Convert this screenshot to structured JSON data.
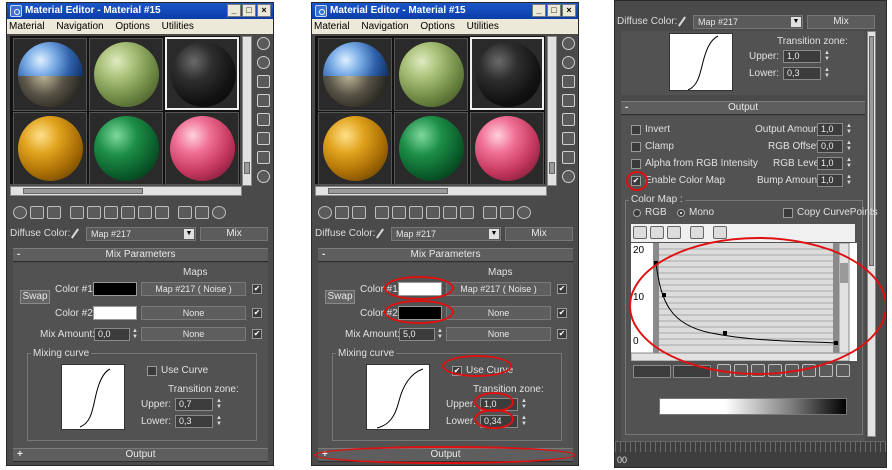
{
  "left_window": {
    "title": "Material Editor - Material #15",
    "menu": [
      "Material",
      "Navigation",
      "Options",
      "Utilities"
    ],
    "diffuse_label": "Diffuse Color:",
    "map_name": "Map #217",
    "mix_button": "Mix",
    "mix_params_title": "Mix Parameters",
    "maps_header": "Maps",
    "swap": "Swap",
    "color1_label": "Color #1",
    "color2_label": "Color #2",
    "color1_map": "Map #217 ( Noise )",
    "color2_map": "None",
    "mix_amount_label": "Mix Amount:",
    "mix_amount": "0,0",
    "mix_amount_map": "None",
    "mixing_curve_label": "Mixing curve",
    "use_curve_label": "Use Curve",
    "transition_label": "Transition zone:",
    "upper_label": "Upper:",
    "upper": "0,7",
    "lower_label": "Lower:",
    "lower": "0,3",
    "output_title": "Output",
    "color1_hex": "#000000",
    "color2_hex": "#ffffff"
  },
  "mid_window": {
    "title": "Material Editor - Material #15",
    "menu": [
      "Material",
      "Navigation",
      "Options",
      "Utilities"
    ],
    "diffuse_label": "Diffuse Color:",
    "map_name": "Map #217",
    "mix_button": "Mix",
    "mix_params_title": "Mix Parameters",
    "maps_header": "Maps",
    "swap": "Swap",
    "color1_label": "Color #1",
    "color2_label": "Color #2",
    "color1_map": "Map #217 ( Noise )",
    "color2_map": "None",
    "mix_amount_label": "Mix Amount:",
    "mix_amount": "5,0",
    "mix_amount_map": "None",
    "mixing_curve_label": "Mixing curve",
    "use_curve_label": "Use Curve",
    "transition_label": "Transition zone:",
    "upper_label": "Upper:",
    "upper": "1,0",
    "lower_label": "Lower:",
    "lower": "0,34",
    "output_title": "Output",
    "color1_hex": "#ffffff",
    "color2_hex": "#000000"
  },
  "right_window": {
    "diffuse_label": "Diffuse Color:",
    "map_name": "Map #217",
    "mix_button": "Mix",
    "transition_label": "Transition zone:",
    "upper_label": "Upper:",
    "upper": "1,0",
    "lower_label": "Lower:",
    "lower": "0,3",
    "output_title": "Output",
    "invert": "Invert",
    "clamp": "Clamp",
    "alpha_rgb": "Alpha from RGB Intensity",
    "enable_color_map": "Enable Color Map",
    "output_amount_label": "Output Amount:",
    "output_amount": "1,0",
    "rgb_offset_label": "RGB Offset:",
    "rgb_offset": "0,0",
    "rgb_level_label": "RGB Level:",
    "rgb_level": "1,0",
    "bump_amount_label": "Bump Amount:",
    "bump_amount": "1,0",
    "color_map_label": "Color Map :",
    "rgb_radio": "RGB",
    "mono_radio": "Mono",
    "copy_curve_points": "Copy CurvePoints",
    "y_ticks": [
      "20",
      "10",
      "0"
    ],
    "status_text": "00"
  }
}
